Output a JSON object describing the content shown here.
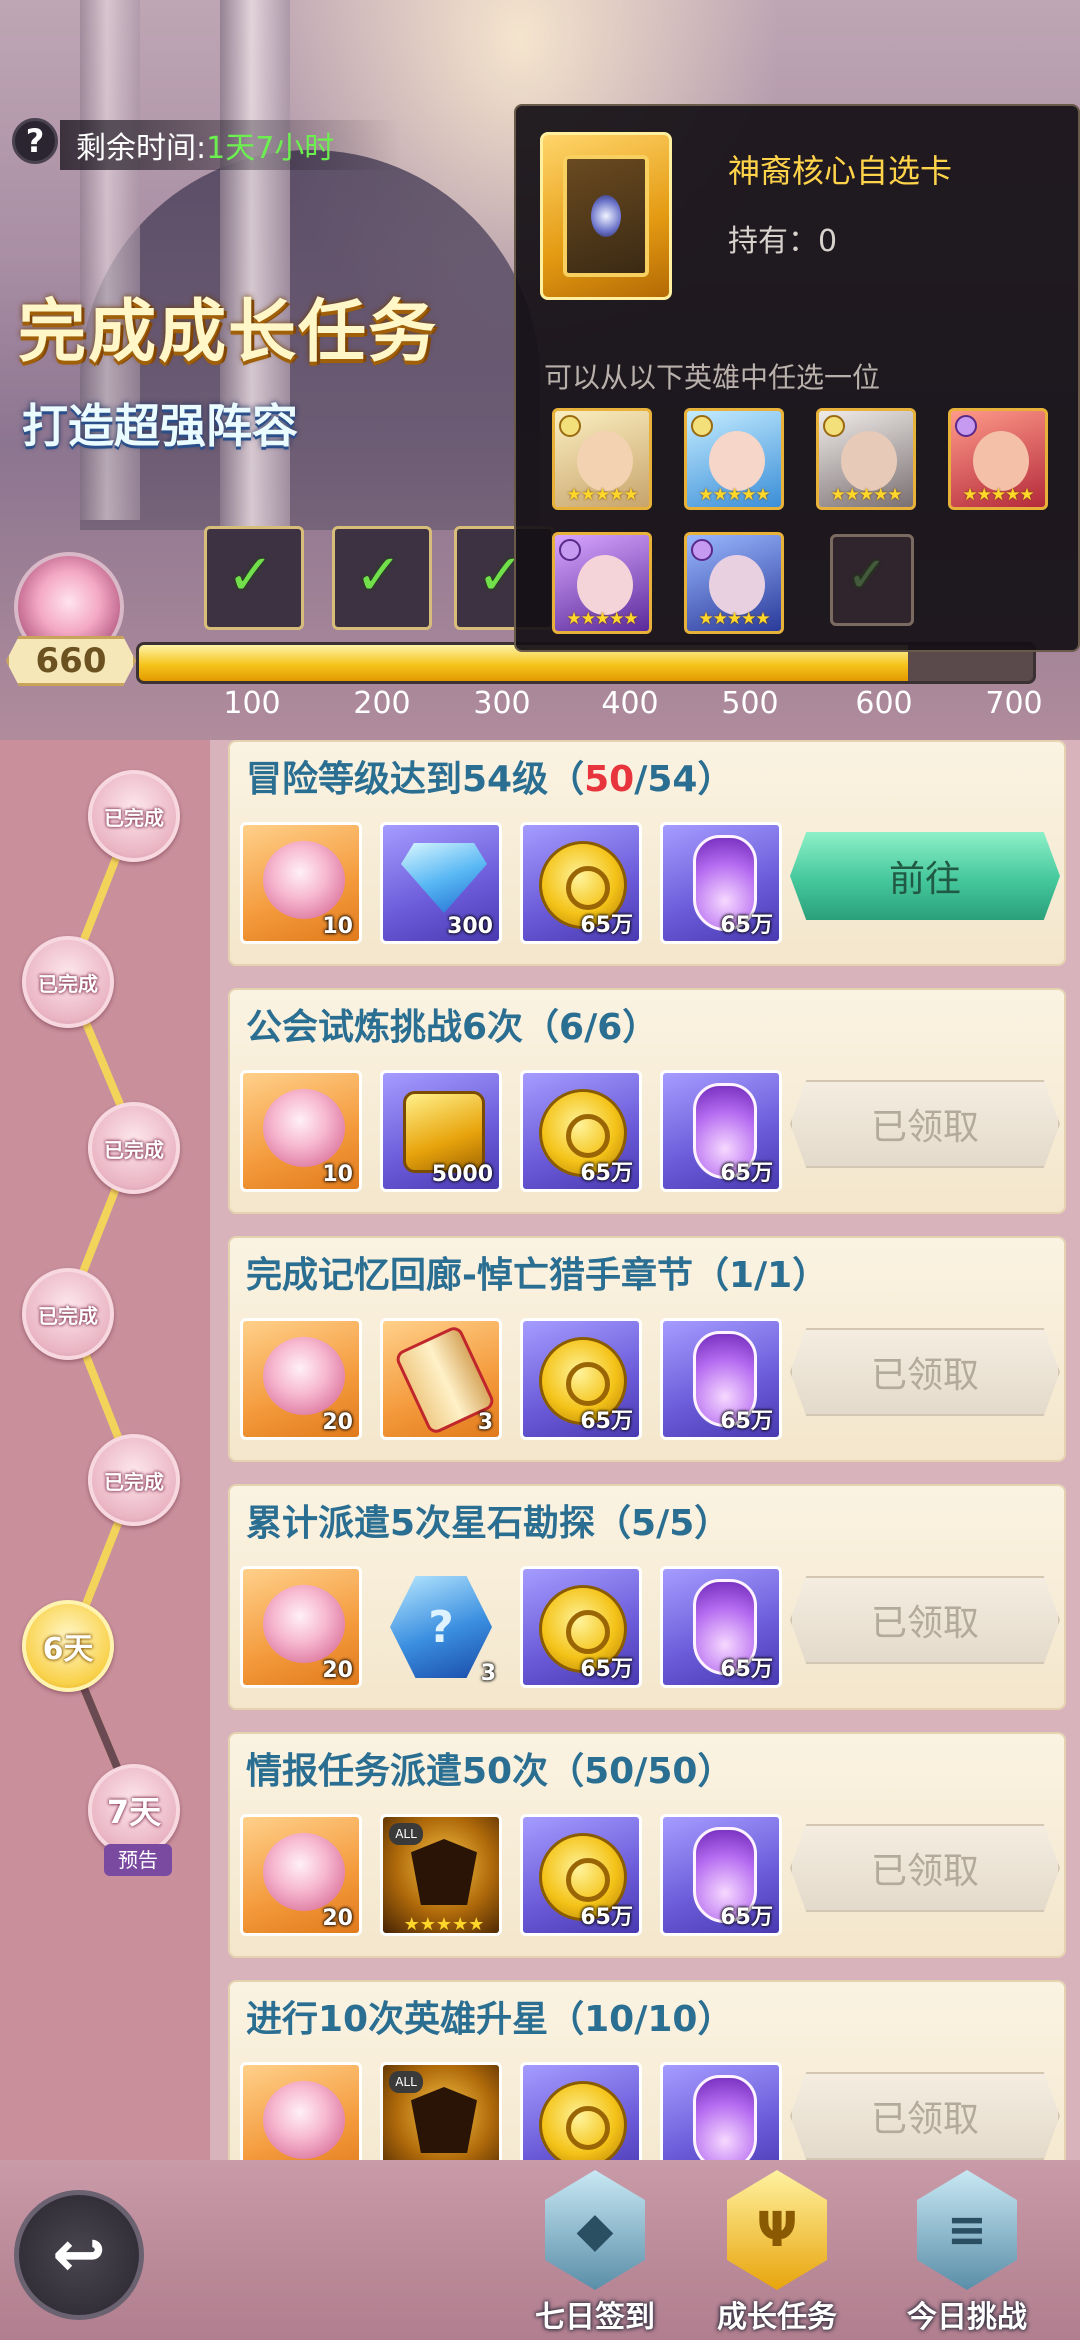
{
  "header": {
    "time_label": "剩余时间:",
    "time_value": "1天7小时",
    "title": "完成成长任务",
    "subtitle": "打造超强阵容"
  },
  "progress": {
    "score": "660",
    "fill_fraction": 0.86,
    "ticks": [
      "100",
      "200",
      "300",
      "400",
      "500",
      "600",
      "700"
    ]
  },
  "popup": {
    "item_name": "神裔核心自选卡",
    "owned": "持有：0",
    "hint": "可以从以下英雄中任选一位",
    "heroes": [
      {
        "name": "hero-1",
        "stars": "★★★★★",
        "element": "light"
      },
      {
        "name": "hero-2",
        "stars": "★★★★★",
        "element": "light"
      },
      {
        "name": "hero-3",
        "stars": "★★★★★",
        "element": "light"
      },
      {
        "name": "hero-4",
        "stars": "★★★★★",
        "element": "dark"
      },
      {
        "name": "hero-5",
        "stars": "★★★★★",
        "element": "dark"
      },
      {
        "name": "hero-6",
        "stars": "★★★★★",
        "element": "dark"
      }
    ]
  },
  "timeline": {
    "done_label": "已完成",
    "current_day": "6天",
    "next_day": "7天",
    "preview_label": "预告"
  },
  "tasks": [
    {
      "title_prefix": "冒险等级达到54级（",
      "progress_current": "50",
      "progress_rest": "/54）",
      "rewards": [
        "10",
        "300",
        "65万",
        "65万"
      ],
      "button": "前往"
    },
    {
      "title": "公会试炼挑战6次（6/6）",
      "rewards": [
        "10",
        "5000",
        "65万",
        "65万"
      ],
      "button": "已领取"
    },
    {
      "title": "完成记忆回廊-悼亡猎手章节（1/1）",
      "rewards": [
        "20",
        "3",
        "65万",
        "65万"
      ],
      "button": "已领取"
    },
    {
      "title": "累计派遣5次星石勘探（5/5）",
      "rewards": [
        "20",
        "3",
        "65万",
        "65万"
      ],
      "button": "已领取"
    },
    {
      "title": "情报任务派遣50次（50/50）",
      "rewards": [
        "20",
        "",
        "65万",
        "65万"
      ],
      "button": "已领取"
    },
    {
      "title": "进行10次英雄升星（10/10）",
      "rewards": [
        "",
        "",
        "",
        ""
      ],
      "button": "已领取"
    }
  ],
  "reward_misc": {
    "hex_symbol": "?",
    "all_badge": "ALL",
    "five_stars": "★★★★★"
  },
  "bottom_nav": {
    "tabs": [
      "七日签到",
      "成长任务",
      "今日挑战"
    ]
  },
  "colors": {
    "accent_gold": "#f5c41c",
    "progress_green": "#6cf050",
    "task_title": "#2a6e92",
    "highlight_red": "#e8343c",
    "go_button": "#45c79c"
  }
}
